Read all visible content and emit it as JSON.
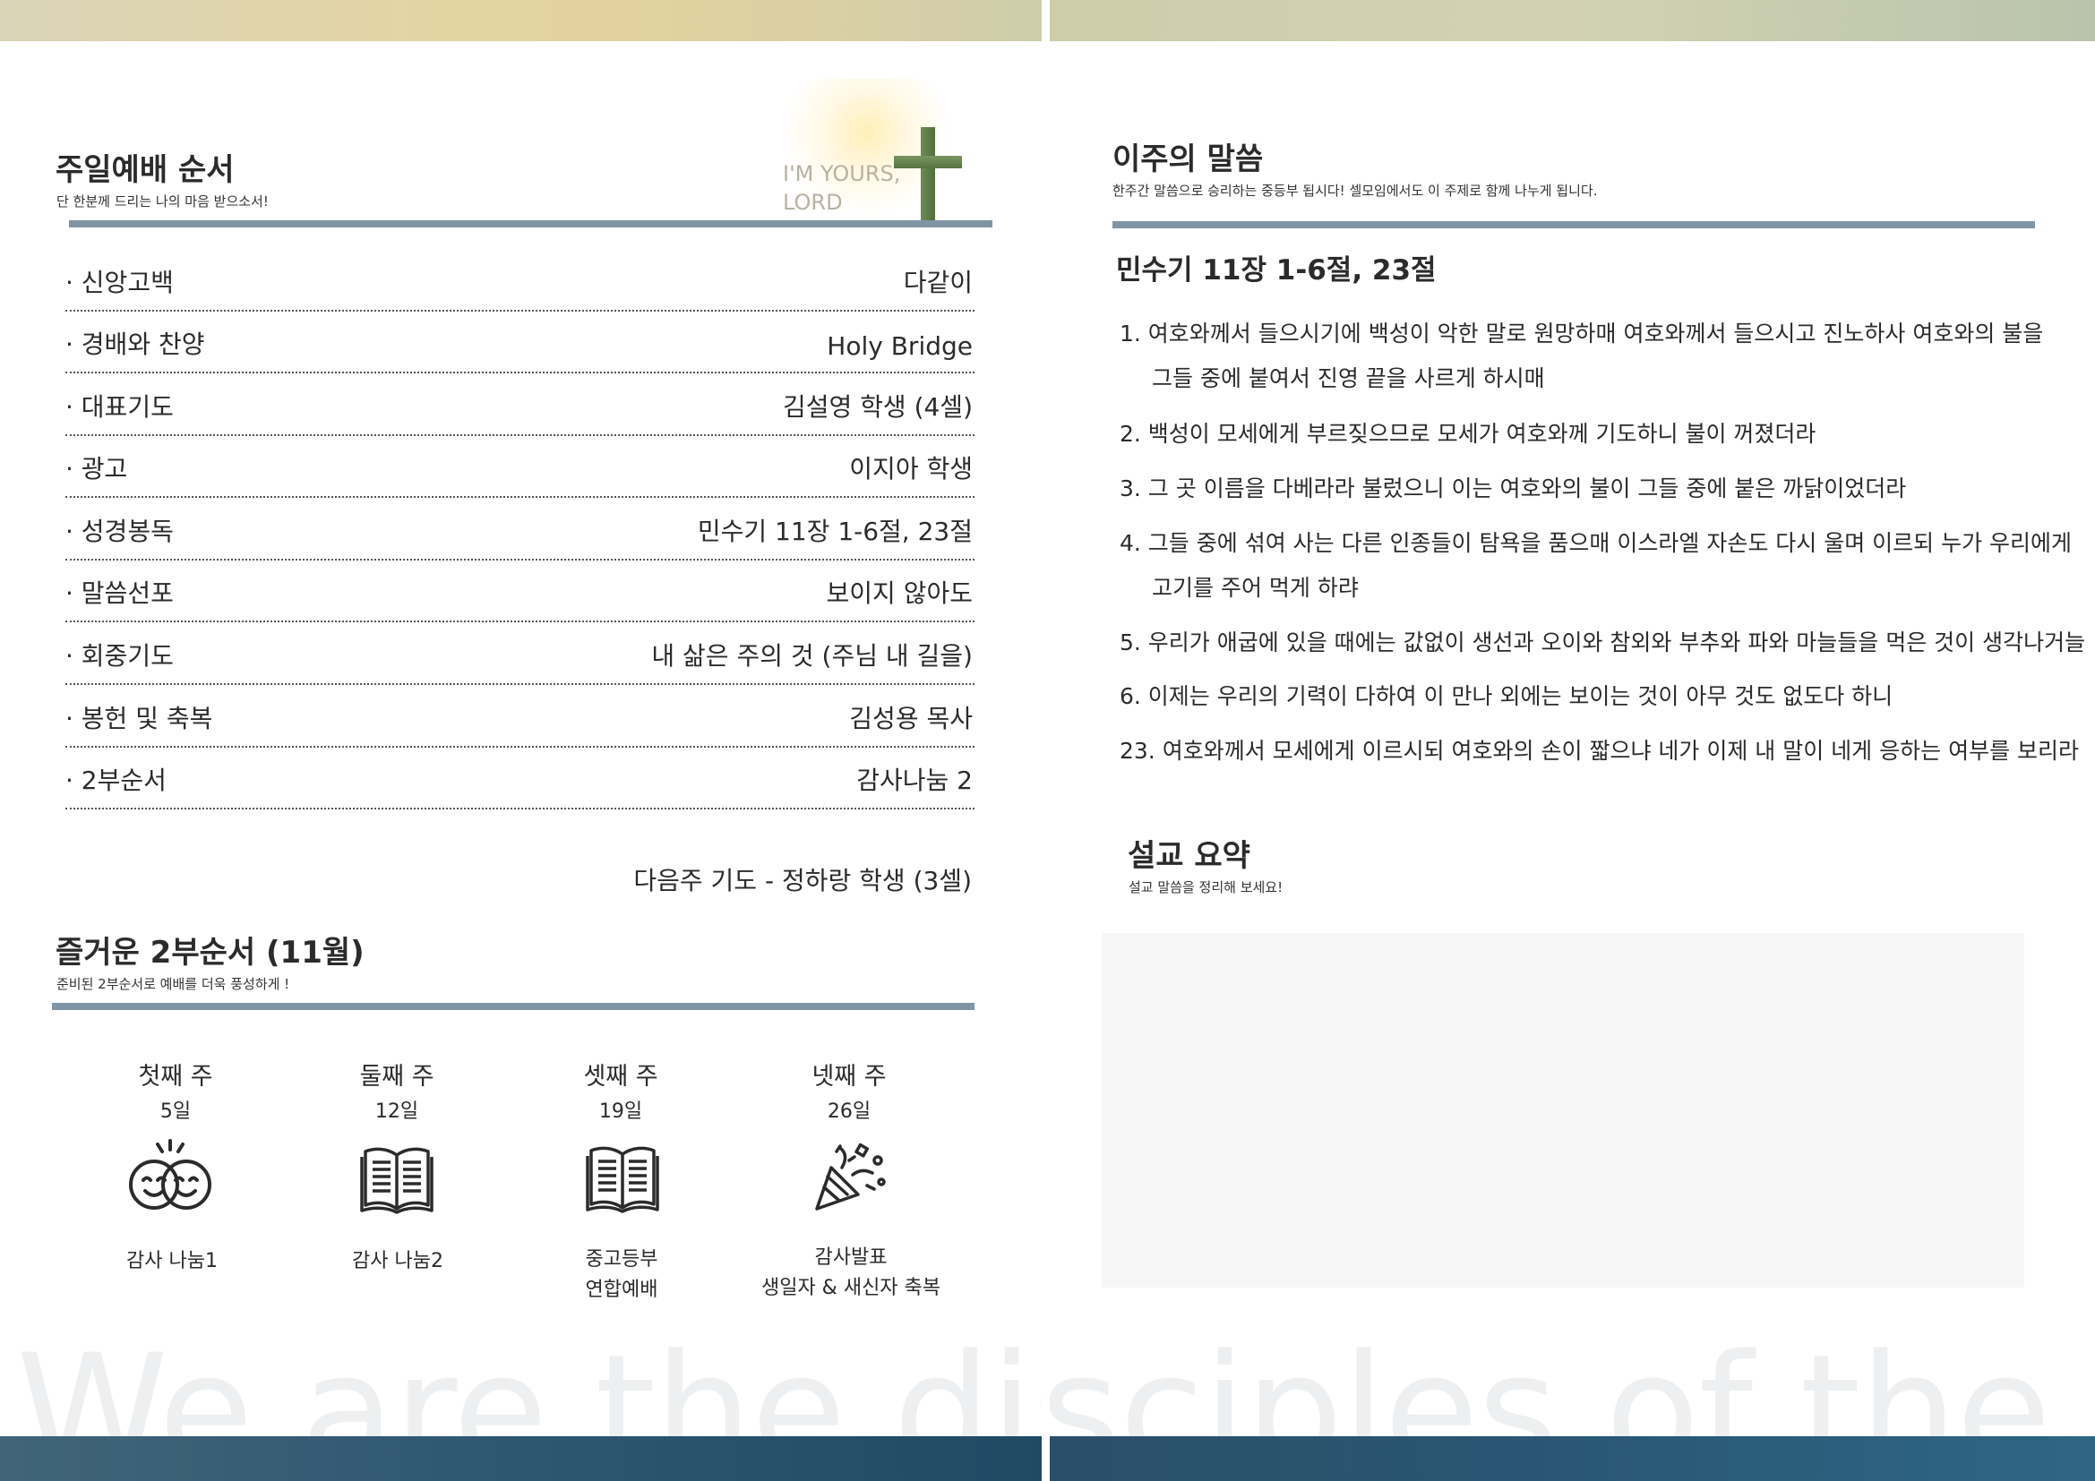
{
  "left": {
    "worship": {
      "title": "주일예배 순서",
      "subtitle": "단 한분께 드리는 나의 마음 받으소서!",
      "cross_text_line1": "I'M YOURS,",
      "cross_text_line2": "LORD",
      "items": [
        {
          "label": "· 신앙고백",
          "value": "다같이"
        },
        {
          "label": "· 경배와 찬양",
          "value": "Holy Bridge"
        },
        {
          "label": "· 대표기도",
          "value": "김설영 학생 (4셀)"
        },
        {
          "label": "· 광고",
          "value": "이지아 학생"
        },
        {
          "label": "· 성경봉독",
          "value": "민수기 11장 1-6절, 23절"
        },
        {
          "label": "· 말씀선포",
          "value": "보이지 않아도"
        },
        {
          "label": "· 회중기도",
          "value": "내 삶은 주의 것 (주님 내 길을)"
        },
        {
          "label": "· 봉헌 및 축복",
          "value": "김성용 목사"
        },
        {
          "label": "· 2부순서",
          "value": "감사나눔 2"
        }
      ],
      "next_prayer": "다음주 기도  -  정하랑 학생 (3셀)"
    },
    "program": {
      "title": "즐거운 2부순서 (11월)",
      "subtitle": "준비된 2부순서로 예배를 더욱 풍성하게 !",
      "weeks": [
        {
          "name": "첫째 주",
          "date": "5일",
          "icon": "two-smiling-faces-icon",
          "caption_line1": "감사 나눔1",
          "caption_line2": ""
        },
        {
          "name": "둘째 주",
          "date": "12일",
          "icon": "open-book-icon",
          "caption_line1": "감사 나눔2",
          "caption_line2": ""
        },
        {
          "name": "셋째 주",
          "date": "19일",
          "icon": "open-book-icon",
          "caption_line1": "중고등부",
          "caption_line2": "연합예배"
        },
        {
          "name": "넷째 주",
          "date": "26일",
          "icon": "party-popper-icon",
          "caption_line1": "감사발표",
          "caption_line2": "생일자 & 새신자 축복"
        }
      ]
    },
    "watermark": "We are the disciples of the Lord"
  },
  "right": {
    "word": {
      "title": "이주의 말씀",
      "subtitle": "한주간 말씀으로 승리하는 중등부 됩시다! 셀모임에서도 이 주제로 함께 나누게 됩니다.",
      "passage": "민수기 11장 1-6절, 23절",
      "verses": [
        {
          "line1": "1. 여호와께서 들으시기에 백성이 악한 말로 원망하매 여호와께서 들으시고 진노하사 여호와의 불을",
          "line2": "그들 중에 붙여서 진영 끝을 사르게 하시매"
        },
        {
          "line1": "2. 백성이 모세에게 부르짖으므로 모세가 여호와께 기도하니 불이 꺼졌더라",
          "line2": ""
        },
        {
          "line1": "3. 그 곳 이름을 다베라라 불렀으니 이는 여호와의 불이 그들 중에 붙은 까닭이었더라",
          "line2": ""
        },
        {
          "line1": "4. 그들 중에 섞여 사는 다른 인종들이 탐욕을 품으매 이스라엘 자손도 다시 울며 이르되 누가 우리에게",
          "line2": "고기를 주어 먹게 하랴"
        },
        {
          "line1": "5. 우리가 애굽에 있을 때에는 값없이 생선과 오이와 참외와 부추와 파와 마늘들을 먹은 것이 생각나거늘",
          "line2": ""
        },
        {
          "line1": "6. 이제는 우리의 기력이 다하여 이 만나 외에는 보이는 것이 아무 것도 없도다 하니",
          "line2": ""
        },
        {
          "line1": "23. 여호와께서 모세에게 이르시되 여호와의 손이 짧으냐 네가 이제 내 말이 네게 응하는 여부를 보리라",
          "line2": ""
        }
      ]
    },
    "summary": {
      "title": "설교 요약",
      "subtitle": "설교 말씀을 정리해 보세요!"
    },
    "watermark": "We are the disciples of the Lord"
  }
}
